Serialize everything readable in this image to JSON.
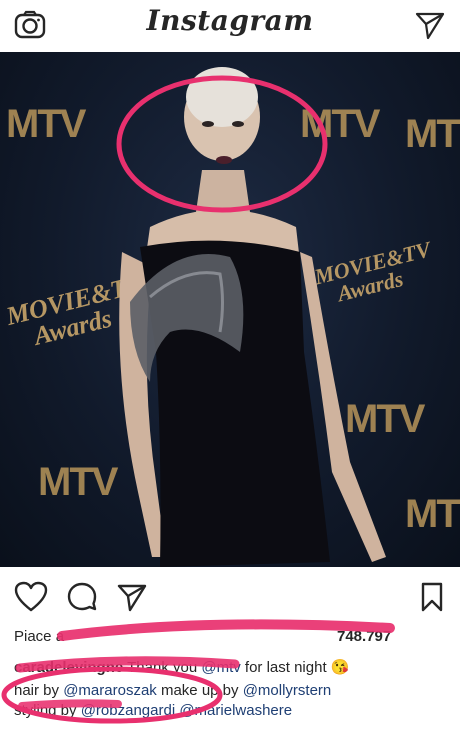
{
  "header": {
    "brand": "Instagram",
    "camera_icon": "camera-icon",
    "direct_icon": "paper-plane-icon"
  },
  "photo": {
    "backdrop_logos": [
      "MTV",
      "MTV",
      "MTV",
      "MTV",
      "MTV",
      "MTV"
    ],
    "award_text_line1": "MOVIE&TV",
    "award_text_line2": "Awards",
    "accent_color": "#e8306e"
  },
  "actions": {
    "like_icon": "heart-icon",
    "comment_icon": "comment-icon",
    "share_icon": "paper-plane-icon",
    "save_icon": "bookmark-icon"
  },
  "likes": {
    "prefix": "Piace a",
    "count_text": "748.797"
  },
  "caption": {
    "username": "caradelevingne",
    "line1_text": "Thank you",
    "mention_mtv": "@mtv",
    "line1_rest": "for last night",
    "emoji": "😘",
    "line2_hair": "hair by",
    "mention_hair": "@mararoszak",
    "line2_makeup": "make up by",
    "mention_makeup": "@mollyrstern",
    "line3_styling": "styling by",
    "mention_styling": "@robzangardi",
    "mention_extra": "@marielwashere"
  }
}
